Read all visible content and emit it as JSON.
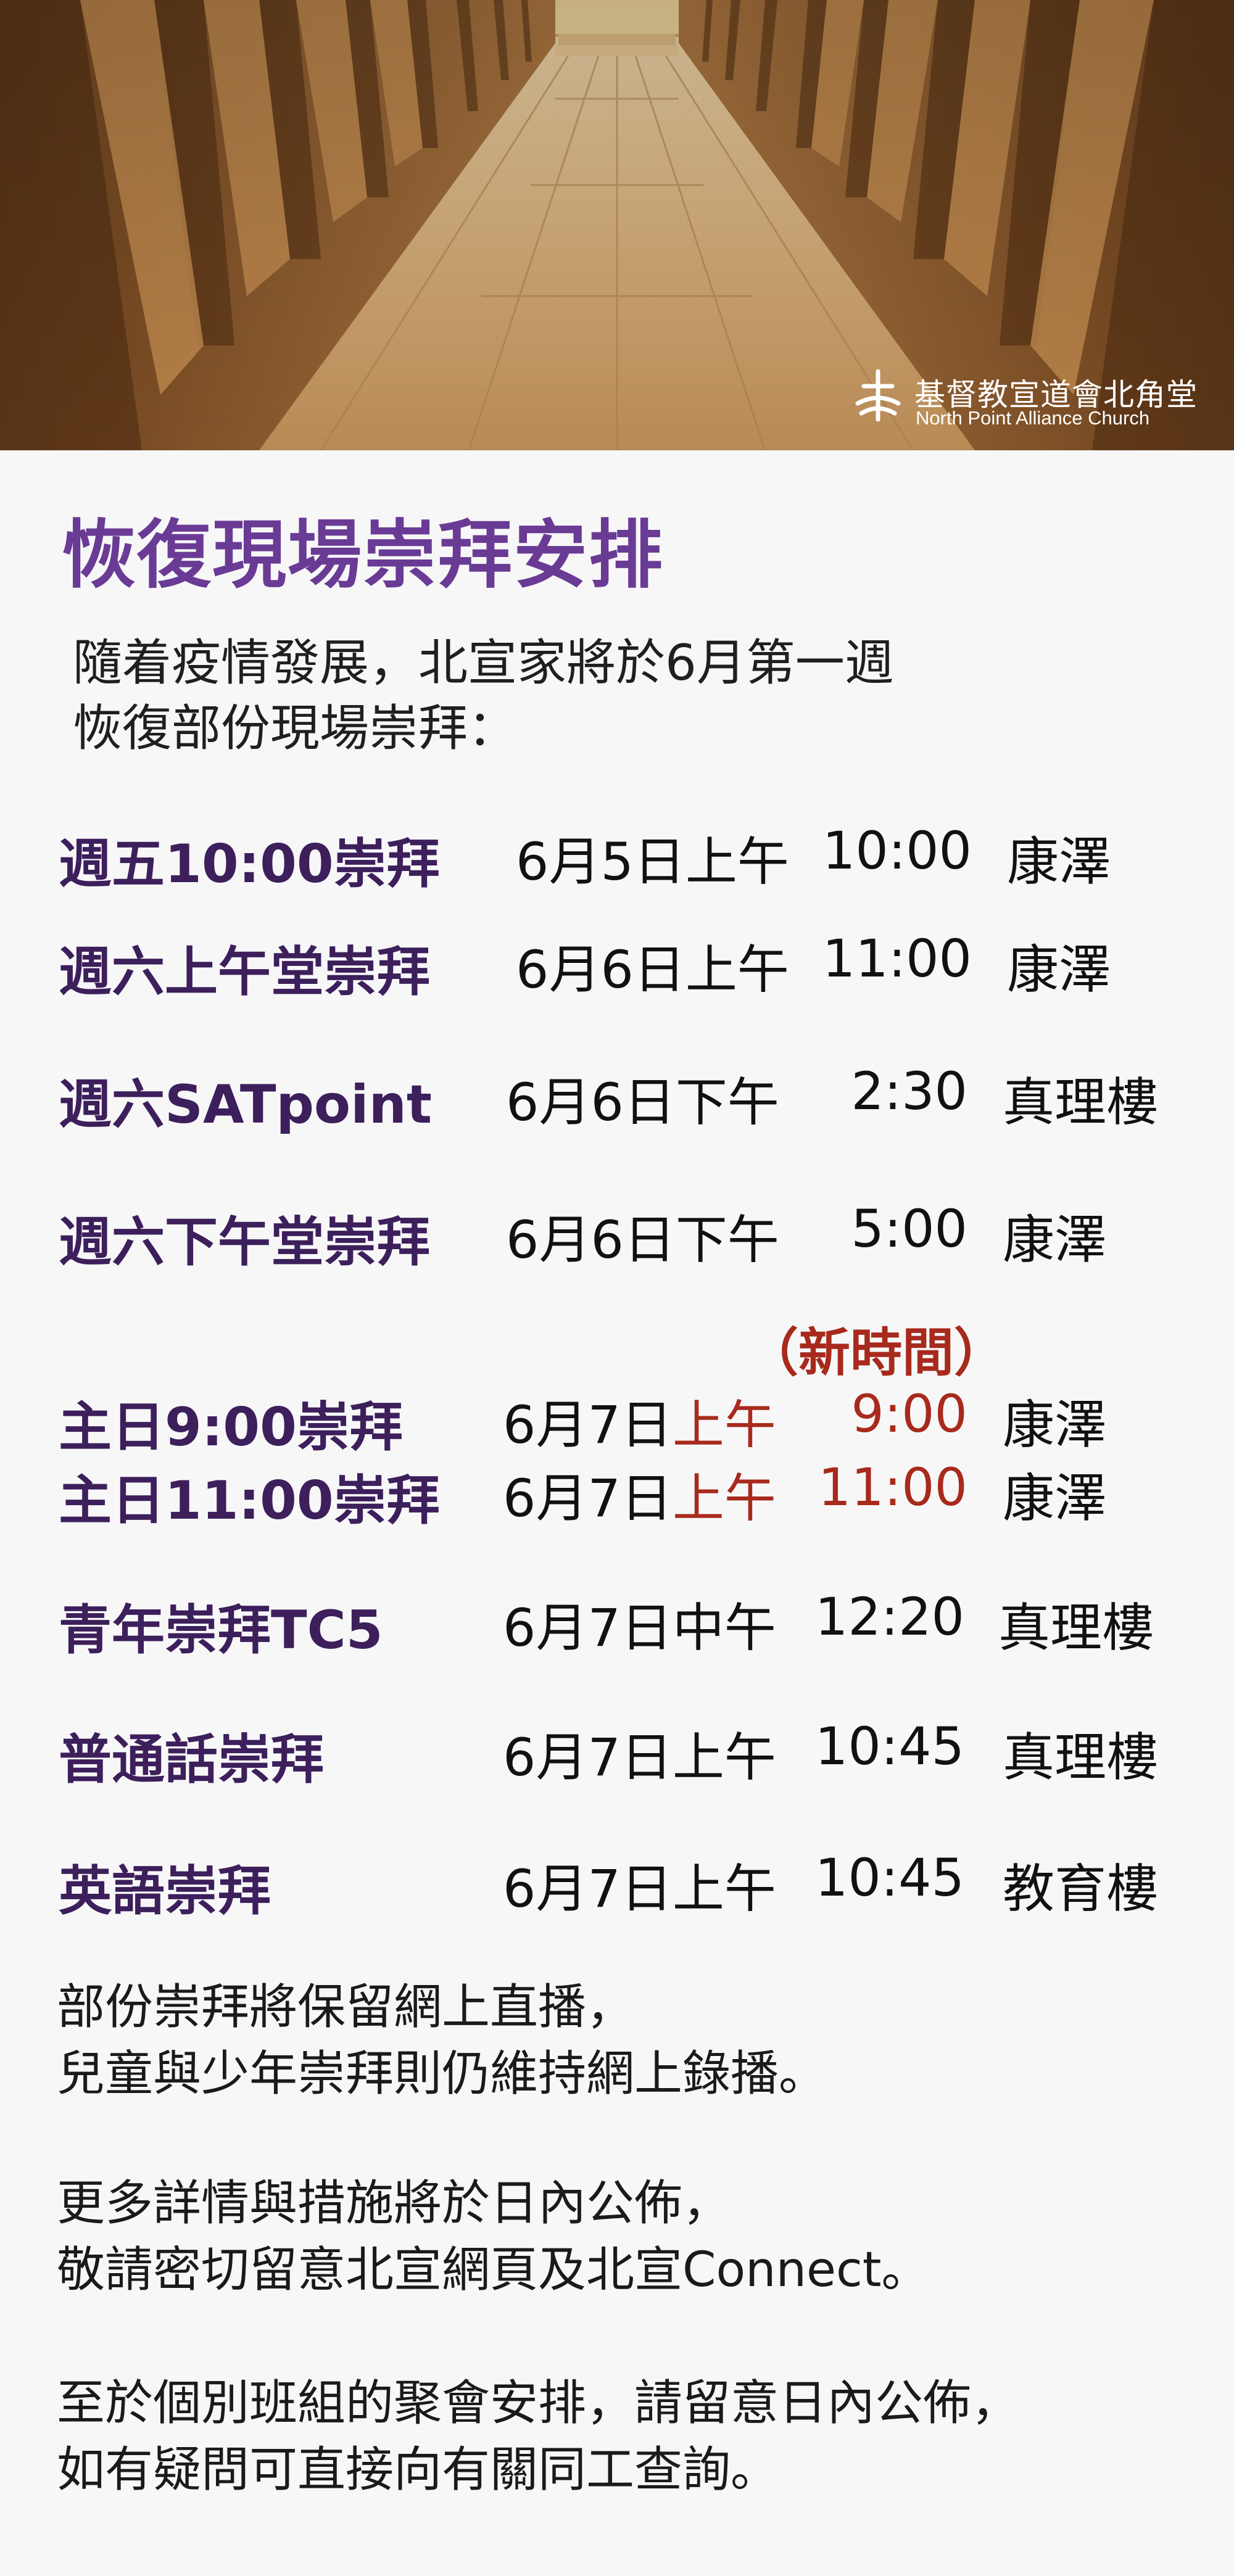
{
  "logo": {
    "name_cn": "基督教宣道會北角堂",
    "name_en": "North Point Alliance Church",
    "mark": "church-cross-logo-icon"
  },
  "title": "恢復現場崇拜安排",
  "intro": {
    "line1": "隨着疫情發展，北宣家將於6月第一週",
    "line2": "恢復部份現場崇拜："
  },
  "new_time_label": "（新時間）",
  "services": [
    {
      "name": "週五10:00崇拜",
      "date": "6月5日",
      "ampm": "上午",
      "time": "10:00",
      "venue": "康澤"
    },
    {
      "name": "週六上午堂崇拜",
      "date": "6月6日",
      "ampm": "上午",
      "time": "11:00",
      "venue": "康澤"
    },
    {
      "name": "週六SATpoint",
      "date": "6月6日",
      "ampm": "下午",
      "time": "2:30",
      "venue": "真理樓"
    },
    {
      "name": "週六下午堂崇拜",
      "date": "6月6日",
      "ampm": "下午",
      "time": "5:00",
      "venue": "康澤"
    },
    {
      "name": "主日9:00崇拜",
      "date": "6月7日",
      "ampm": "上午",
      "time": "9:00",
      "venue": "康澤"
    },
    {
      "name": "主日11:00崇拜",
      "date": "6月7日",
      "ampm": "上午",
      "time": "11:00",
      "venue": "康澤"
    },
    {
      "name": "青年崇拜TC5",
      "date": "6月7日",
      "ampm": "中午",
      "time": "12:20",
      "venue": "真理樓"
    },
    {
      "name": "普通話崇拜",
      "date": "6月7日",
      "ampm": "上午",
      "time": "10:45",
      "venue": "真理樓"
    },
    {
      "name": "英語崇拜",
      "date": "6月7日",
      "ampm": "上午",
      "time": "10:45",
      "venue": "教育樓"
    }
  ],
  "notes": [
    {
      "line1": "部份崇拜將保留網上直播，",
      "line2": "兒童與少年崇拜則仍維持網上錄播。"
    },
    {
      "line1": "更多詳情與措施將於日內公佈，",
      "line2": "敬請密切留意北宣網頁及北宣Connect。"
    },
    {
      "line1": "至於個別班組的聚會安排，請留意日內公佈，",
      "line2": "如有疑問可直接向有關同工查詢。"
    }
  ],
  "colors": {
    "title": "#6a3b95",
    "service_name": "#3c1f5b",
    "highlight_red": "#a82a1c",
    "body_text": "#1a1a1a",
    "background": "#f7f7f8"
  }
}
